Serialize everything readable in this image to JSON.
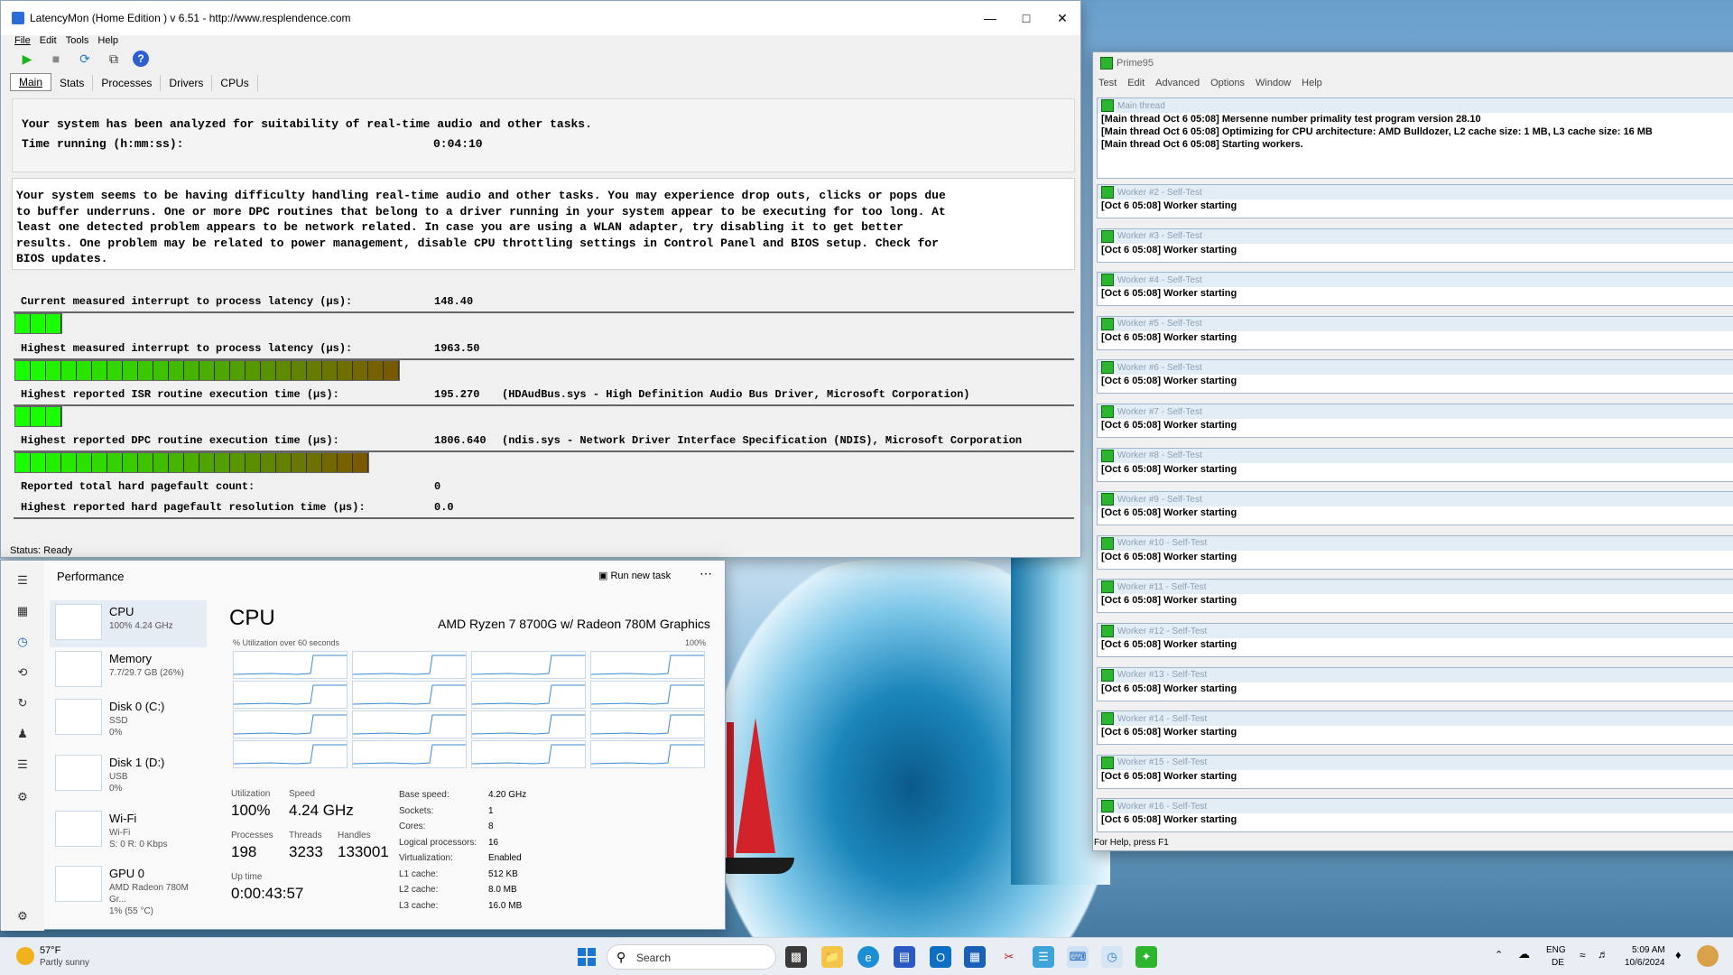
{
  "latencymon": {
    "title": "LatencyMon  (Home Edition )  v 6.51 - http://www.resplendence.com",
    "menu": [
      "File",
      "Edit",
      "Tools",
      "Help"
    ],
    "tabs": [
      "Main",
      "Stats",
      "Processes",
      "Drivers",
      "CPUs"
    ],
    "analyzed": "Your system has been analyzed for suitability of real-time audio and other tasks.",
    "time_label": "Time running (h:mm:ss):",
    "time_value": "0:04:10",
    "verdict": [
      "Your system seems to be having difficulty handling real-time audio and other tasks. You may experience drop outs, clicks or pops due",
      "to buffer underruns. One or more DPC routines that belong to a driver running in your system appear to be executing for too long. At",
      "least one detected problem appears to be network related. In case you are using a WLAN adapter, try disabling it to get better",
      "results. One problem may be related to power management, disable CPU throttling settings in Control Panel and BIOS setup. Check for",
      "BIOS updates."
    ],
    "rows": [
      {
        "label": "Current measured interrupt to process latency (µs):",
        "value": "148.40",
        "extra": ""
      },
      {
        "label": "Highest measured interrupt to process latency (µs):",
        "value": "1963.50",
        "extra": ""
      },
      {
        "label": "Highest reported ISR routine execution time (µs):",
        "value": "195.270",
        "extra": "(HDAudBus.sys - High Definition Audio Bus Driver, Microsoft Corporation)"
      },
      {
        "label": "Highest reported DPC routine execution time (µs):",
        "value": "1806.640",
        "extra": "(ndis.sys - Network Driver Interface Specification (NDIS), Microsoft Corporation"
      },
      {
        "label": "Reported total hard pagefault count:",
        "value": "0",
        "extra": ""
      },
      {
        "label": "Highest reported hard pagefault resolution time (µs):",
        "value": "0.0",
        "extra": ""
      }
    ],
    "bar_segments": [
      3,
      25,
      3,
      23
    ],
    "status": "Status: Ready"
  },
  "prime95": {
    "title": "Prime95",
    "menu": [
      "Test",
      "Edit",
      "Advanced",
      "Options",
      "Window",
      "Help"
    ],
    "main_title": "Main thread",
    "main_lines": [
      "[Main thread Oct 6 05:08] Mersenne number primality test program version 28.10",
      "[Main thread Oct 6 05:08] Optimizing for CPU architecture: AMD Bulldozer, L2 cache size: 1 MB, L3 cache size: 16 MB",
      "[Main thread Oct 6 05:08] Starting workers."
    ],
    "workers": [
      "Worker #2 - Self-Test",
      "Worker #3 - Self-Test",
      "Worker #4 - Self-Test",
      "Worker #5 - Self-Test",
      "Worker #6 - Self-Test",
      "Worker #7 - Self-Test",
      "Worker #8 - Self-Test",
      "Worker #9 - Self-Test",
      "Worker #10 - Self-Test",
      "Worker #11 - Self-Test",
      "Worker #12 - Self-Test",
      "Worker #13 - Self-Test",
      "Worker #14 - Self-Test",
      "Worker #15 - Self-Test",
      "Worker #16 - Self-Test"
    ],
    "worker_line": "[Oct 6 05:08] Worker starting",
    "status": "For Help, press F1"
  },
  "taskmgr": {
    "title": "Performance",
    "run_task": "Run new task",
    "more": "⋯",
    "sidebar": [
      {
        "name": "CPU",
        "sub": "100%  4.24 GHz",
        "sub2": ""
      },
      {
        "name": "Memory",
        "sub": "7.7/29.7 GB (26%)",
        "sub2": ""
      },
      {
        "name": "Disk 0 (C:)",
        "sub": "SSD",
        "sub2": "0%"
      },
      {
        "name": "Disk 1 (D:)",
        "sub": "USB",
        "sub2": "0%"
      },
      {
        "name": "Wi-Fi",
        "sub": "Wi-Fi",
        "sub2": "S: 0 R: 0 Kbps"
      },
      {
        "name": "GPU 0",
        "sub": "AMD Radeon 780M Gr...",
        "sub2": "1% (55 °C)"
      }
    ],
    "cpu_heading": "CPU",
    "cpu_model": "AMD Ryzen 7 8700G w/ Radeon 780M Graphics",
    "util_label": "% Utilization over 60 seconds",
    "util_max": "100%",
    "stats": {
      "utilization_l": "Utilization",
      "utilization": "100%",
      "speed_l": "Speed",
      "speed": "4.24 GHz",
      "processes_l": "Processes",
      "processes": "198",
      "threads_l": "Threads",
      "threads": "3233",
      "handles_l": "Handles",
      "handles": "133001",
      "uptime_l": "Up time",
      "uptime": "0:00:43:57"
    },
    "specs": [
      {
        "l": "Base speed:",
        "v": "4.20 GHz"
      },
      {
        "l": "Sockets:",
        "v": "1"
      },
      {
        "l": "Cores:",
        "v": "8"
      },
      {
        "l": "Logical processors:",
        "v": "16"
      },
      {
        "l": "Virtualization:",
        "v": "Enabled"
      },
      {
        "l": "L1 cache:",
        "v": "512 KB"
      },
      {
        "l": "L2 cache:",
        "v": "8.0 MB"
      },
      {
        "l": "L3 cache:",
        "v": "16.0 MB"
      }
    ]
  },
  "taskbar": {
    "weather_temp": "57°F",
    "weather_desc": "Partly sunny",
    "search": "Search",
    "lang1": "ENG",
    "lang2": "DE",
    "time": "5:09 AM",
    "date": "10/6/2024"
  },
  "colors": {
    "bar_green": "#1aff00",
    "bar_dark": "#7a5a00"
  }
}
